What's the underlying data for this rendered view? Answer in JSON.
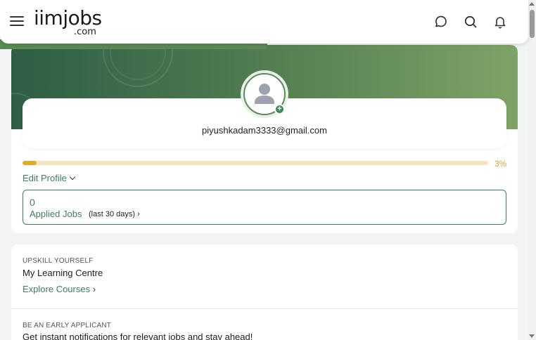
{
  "header": {
    "logo_main": "iimjobs",
    "logo_sub": ".com",
    "icons": [
      "menu-icon",
      "chat-icon",
      "search-icon",
      "bell-icon"
    ]
  },
  "profile": {
    "email": "piyushkadam3333@gmail.com",
    "progress_percent": 3,
    "progress_label": "3%",
    "edit_profile_label": "Edit Profile",
    "applied_count": "0",
    "applied_label": "Applied Jobs",
    "applied_sub": "(last 30 days)"
  },
  "learning": {
    "kicker": "UPSKILL YOURSELF",
    "title": "My Learning Centre",
    "link": "Explore Courses"
  },
  "early": {
    "kicker": "BE AN EARLY APPLICANT",
    "title": "Get instant notifications for relevant jobs and stay ahead!"
  },
  "colors": {
    "brand_green": "#3f7d57",
    "banner_start": "#2f5e46",
    "banner_end": "#7fa366",
    "progress": "#e6a92b",
    "progress_track": "#f7e3bd"
  }
}
